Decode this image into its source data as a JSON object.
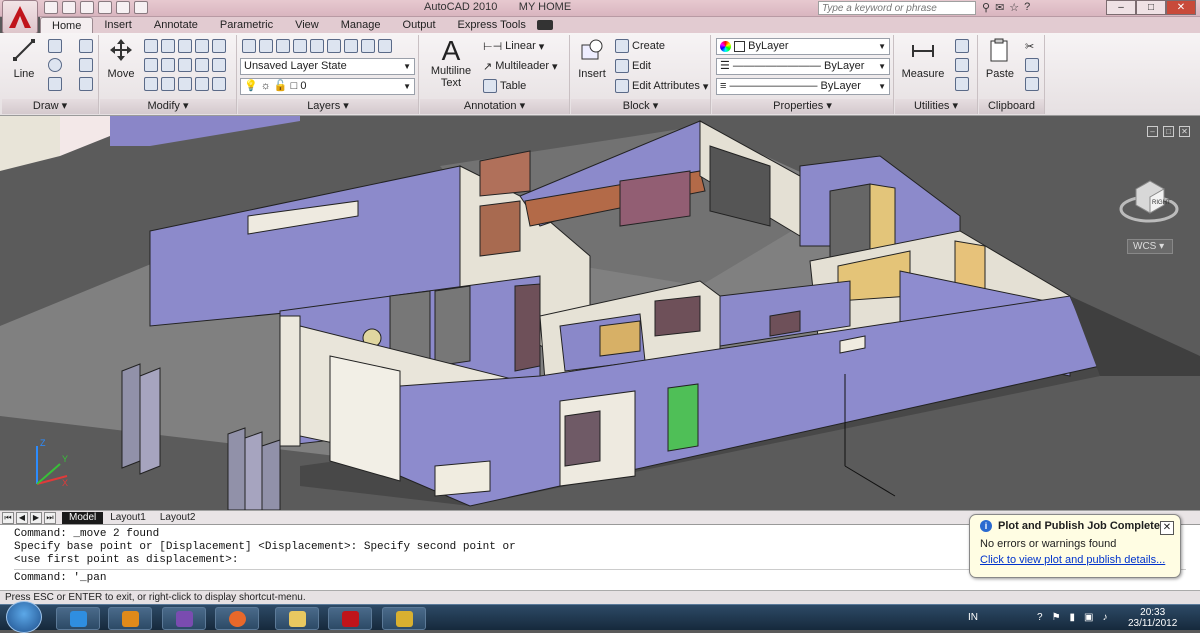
{
  "window": {
    "app_title": "AutoCAD 2010",
    "doc_title": "MY HOME",
    "search_placeholder": "Type a keyword or phrase"
  },
  "ribbon_tabs": [
    "Home",
    "Insert",
    "Annotate",
    "Parametric",
    "View",
    "Manage",
    "Output",
    "Express Tools"
  ],
  "draw": {
    "label": "Draw",
    "line": "Line"
  },
  "modify": {
    "label": "Modify",
    "move": "Move"
  },
  "layers": {
    "label": "Layers",
    "state": "Unsaved Layer State",
    "current": "0"
  },
  "annotation": {
    "label": "Annotation",
    "mtext_line1": "Multiline",
    "mtext_line2": "Text",
    "linear": "Linear",
    "multileader": "Multileader",
    "table": "Table"
  },
  "block": {
    "label": "Block",
    "insert": "Insert",
    "create": "Create",
    "edit": "Edit",
    "edit_attributes": "Edit Attributes"
  },
  "properties": {
    "label": "Properties",
    "color": "ByLayer",
    "linetype": "ByLayer",
    "lineweight": "ByLayer"
  },
  "utilities": {
    "label": "Utilities",
    "measure": "Measure"
  },
  "clipboard": {
    "label": "Clipboard",
    "paste": "Paste"
  },
  "viewport": {
    "wcs": "WCS",
    "cube_face": "RIGHT",
    "axis_x": "X",
    "axis_y": "Y",
    "axis_z": "Z"
  },
  "layout_tabs": [
    "Model",
    "Layout1",
    "Layout2"
  ],
  "command_history": [
    "Command: _move 2 found",
    "Specify base point or [Displacement] <Displacement>: Specify second point or",
    "<use first point as displacement>:"
  ],
  "command_prompt": "Command: '_pan",
  "status_text": "Press ESC or ENTER to exit, or right-click to display shortcut-menu.",
  "notification": {
    "title": "Plot and Publish Job Complete",
    "body": "No errors or warnings found",
    "link": "Click to view plot and publish details..."
  },
  "taskbar": {
    "language": "IN",
    "time": "20:33",
    "date": "23/11/2012"
  }
}
